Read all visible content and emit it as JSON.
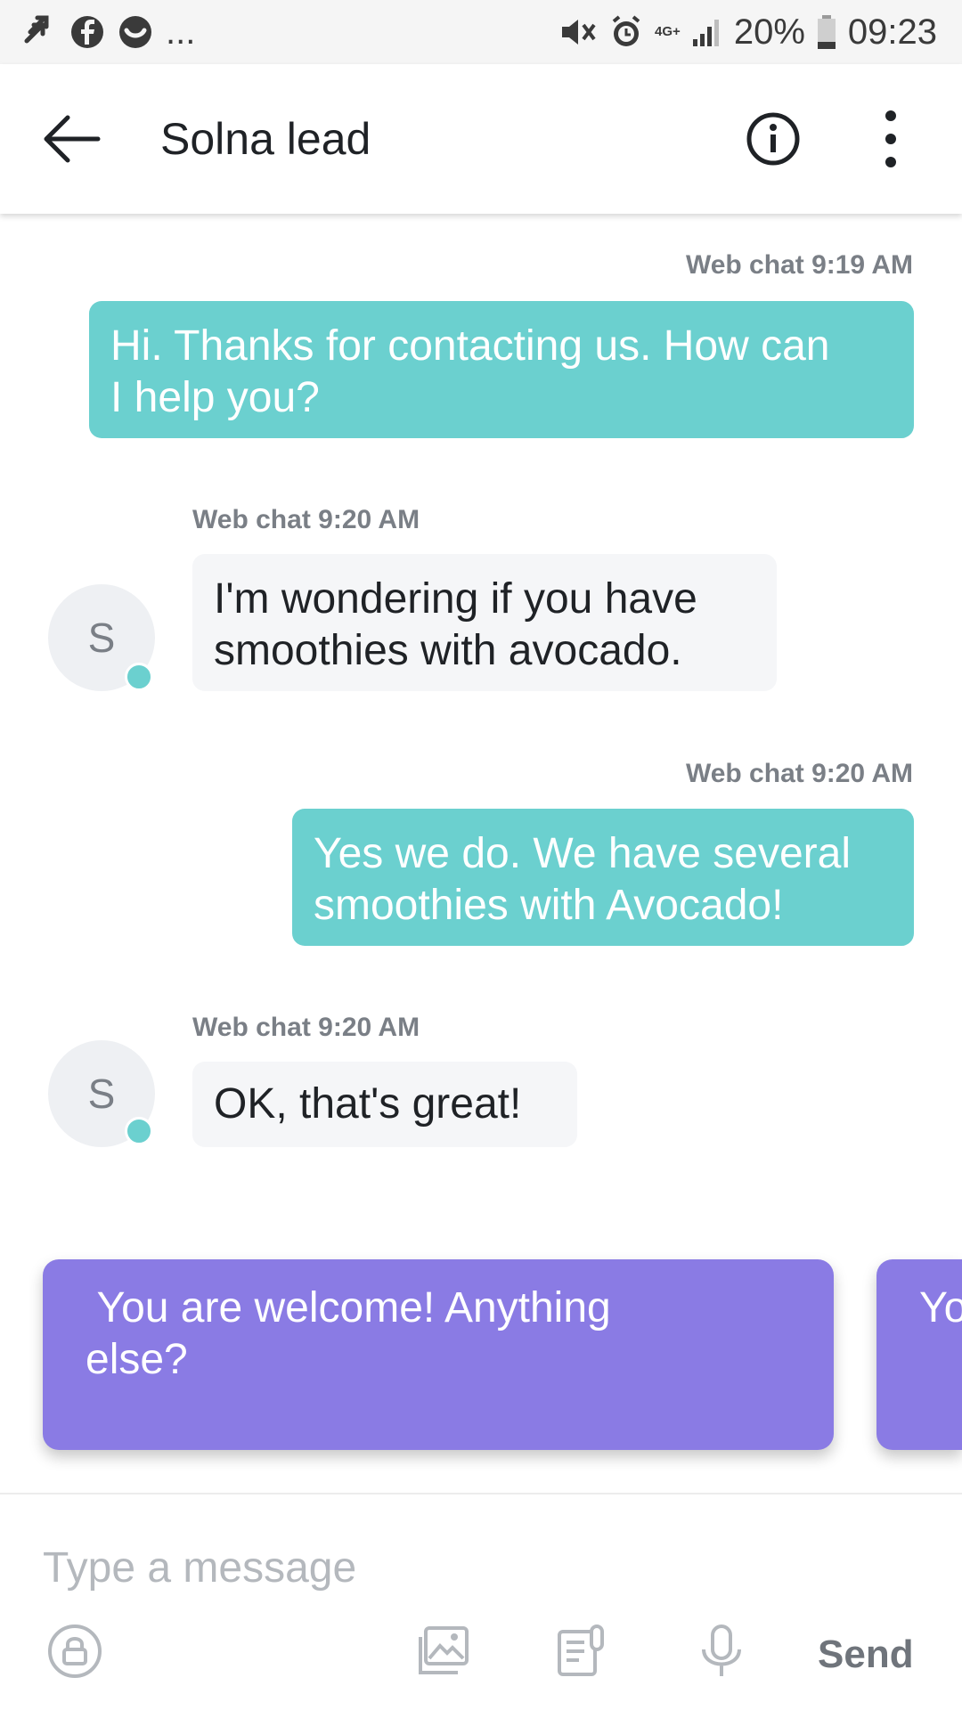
{
  "status_bar": {
    "left_icons": [
      "notification-arrows-icon",
      "facebook-icon",
      "messenger-icon"
    ],
    "more": "...",
    "network": "4G+",
    "battery": "20%",
    "time": "09:23"
  },
  "header": {
    "title": "Solna lead",
    "icons": [
      "back-arrow-icon",
      "info-icon",
      "more-vert-icon"
    ]
  },
  "messages": [
    {
      "direction": "outgoing",
      "meta": "Web chat 9:19 AM",
      "lines": [
        "Hi. Thanks for contacting us. How can",
        "I help you?"
      ]
    },
    {
      "direction": "incoming",
      "meta": "Web chat 9:20 AM",
      "avatar": "S",
      "lines": [
        "I'm wondering if you have",
        "smoothies with avocado."
      ]
    },
    {
      "direction": "outgoing",
      "meta": "Web chat 9:20 AM",
      "lines": [
        "Yes we do. We have several",
        "smoothies with Avocado!"
      ]
    },
    {
      "direction": "incoming",
      "meta": "Web chat 9:20 AM",
      "avatar": "S",
      "lines": [
        "OK, that's great!"
      ]
    }
  ],
  "suggestions": [
    {
      "lines": [
        " You are welcome! Anything",
        "else?"
      ]
    },
    {
      "lines": [
        "Yo"
      ]
    }
  ],
  "composer": {
    "placeholder": "Type a message",
    "send_label": "Send",
    "icons": [
      "lock-icon",
      "image-icon",
      "template-icon",
      "microphone-icon"
    ]
  },
  "colors": {
    "outgoing_bubble": "#6bd0cf",
    "incoming_bubble": "#f5f6f8",
    "suggestion": "#8a7be4",
    "online_dot": "#6bd0cf"
  }
}
